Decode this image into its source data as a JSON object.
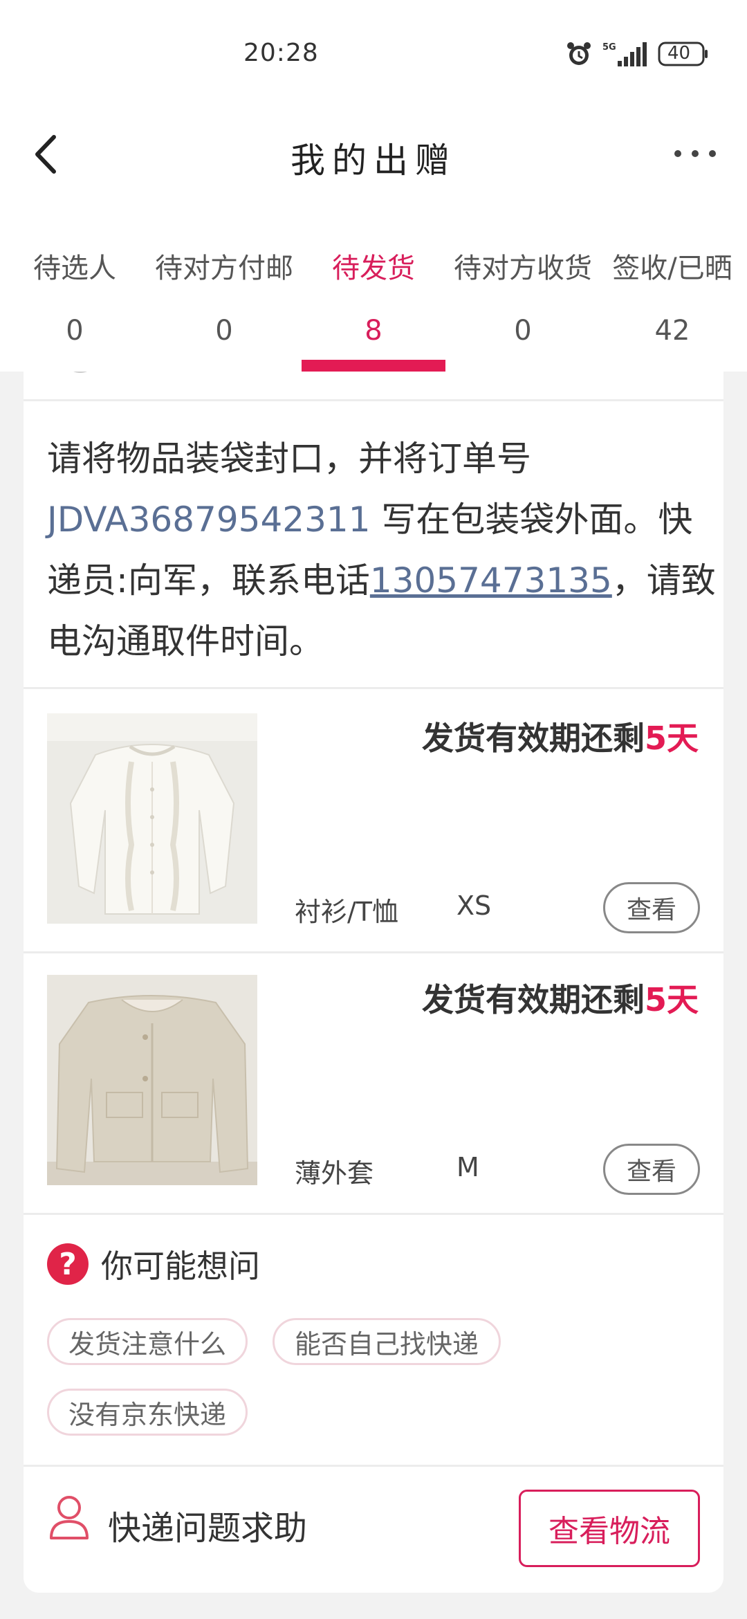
{
  "status_bar": {
    "time": "20:28",
    "network": "5G",
    "battery": "40",
    "icons": [
      "alarm-icon",
      "signal-icon",
      "battery-icon"
    ]
  },
  "nav": {
    "title": "我的出赠",
    "back_icon": "chevron-left-icon",
    "more_icon": "more-dots-icon"
  },
  "tabs": [
    {
      "label": "待选人",
      "count": "0",
      "active": false
    },
    {
      "label": "待对方付邮",
      "count": "0",
      "active": false
    },
    {
      "label": "待发货",
      "count": "8",
      "active": true
    },
    {
      "label": "待对方收货",
      "count": "0",
      "active": false
    },
    {
      "label": "签收/已晒",
      "count": "42",
      "active": false
    }
  ],
  "instructions": {
    "part1": "请将物品装袋封口，并将订单号 ",
    "order_no": "JDVA36879542311",
    "part2": " 写在包装袋外面。快递员:向军，联系电话",
    "phone": "13057473135",
    "part3": "，请致电沟通取件时间。"
  },
  "products": [
    {
      "deadline_prefix": "发货有效期还剩",
      "deadline_days": "5天",
      "category": "衬衫/T恤",
      "size": "XS",
      "view_label": "查看"
    },
    {
      "deadline_prefix": "发货有效期还剩",
      "deadline_days": "5天",
      "category": "薄外套",
      "size": "M",
      "view_label": "查看"
    }
  ],
  "faq": {
    "title": "你可能想问",
    "icon": "question-circle-icon",
    "chips": [
      "发货注意什么",
      "能否自己找快递",
      "没有京东快递"
    ]
  },
  "help": {
    "label": "快递问题求助",
    "icon": "person-icon",
    "logistics_button": "查看物流"
  },
  "colors": {
    "accent": "#e31b54",
    "link": "#5a6f94",
    "background": "#f2f2f2"
  }
}
